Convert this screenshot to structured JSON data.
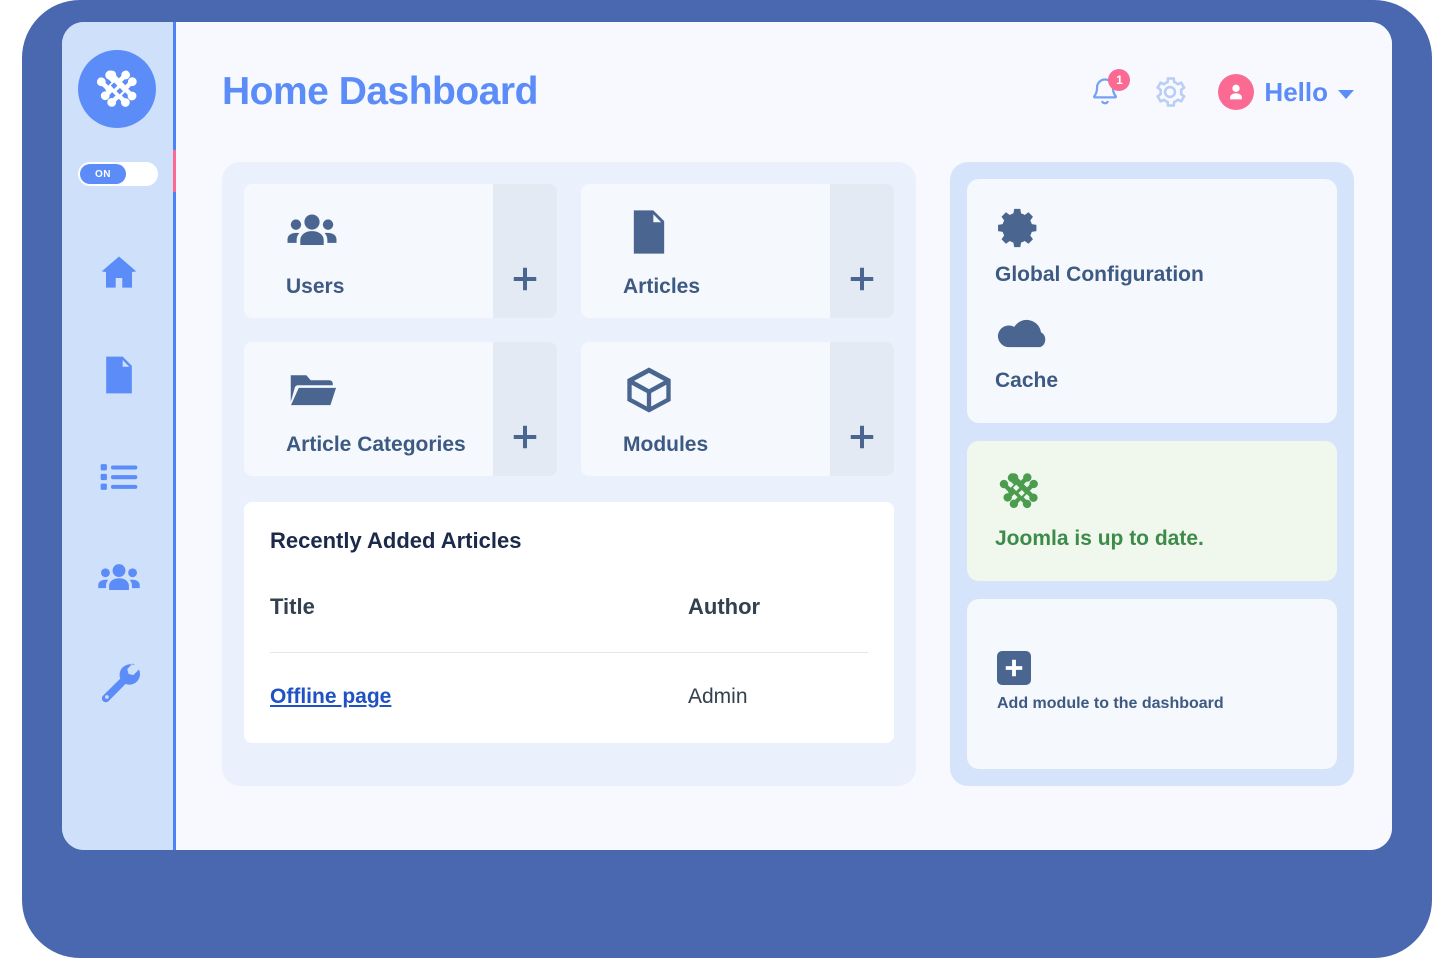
{
  "window": {
    "frame_color": "#4a68b0",
    "surface_color": "#f7f9fe"
  },
  "sidebar": {
    "logo_icon": "joomla-logo-icon",
    "accent_color": "#fb6a93",
    "toggle": {
      "label": "ON",
      "state": "on"
    },
    "items": [
      {
        "icon": "home-icon",
        "name": "home"
      },
      {
        "icon": "document-icon",
        "name": "content"
      },
      {
        "icon": "list-icon",
        "name": "menus"
      },
      {
        "icon": "users-icon",
        "name": "users"
      },
      {
        "icon": "wrench-icon",
        "name": "system"
      }
    ]
  },
  "header": {
    "title": "Home Dashboard",
    "title_color": "#5b8cf8",
    "notifications": {
      "icon": "bell-icon",
      "count": "1",
      "badge_color": "#fb6a93"
    },
    "settings": {
      "icon": "gear-icon"
    },
    "user": {
      "icon": "user-avatar-icon",
      "name": "Hello",
      "caret": "chevron-down-icon"
    }
  },
  "quick_tiles": [
    {
      "icon": "users-icon",
      "label": "Users",
      "add_icon": "plus-icon"
    },
    {
      "icon": "article-icon",
      "label": "Articles",
      "add_icon": "plus-icon"
    },
    {
      "icon": "folder-icon",
      "label": "Article Categories",
      "add_icon": "plus-icon"
    },
    {
      "icon": "cube-icon",
      "label": "Modules",
      "add_icon": "plus-icon"
    }
  ],
  "recent_articles": {
    "title": "Recently Added Articles",
    "columns": [
      "Title",
      "Author"
    ],
    "rows": [
      {
        "title": "Offline page",
        "author": "Admin"
      }
    ]
  },
  "side_panels": {
    "shortcuts": [
      {
        "icon": "gear-icon",
        "label": "Global Configuration"
      },
      {
        "icon": "cloud-icon",
        "label": "Cache"
      }
    ],
    "update_status": {
      "icon": "joomla-logo-icon",
      "message": "Joomla is up to date.",
      "color": "#3d8b49",
      "background": "#f0f8ee"
    },
    "add_module": {
      "icon": "plus-square-icon",
      "label": "Add module to the dashboard"
    }
  }
}
